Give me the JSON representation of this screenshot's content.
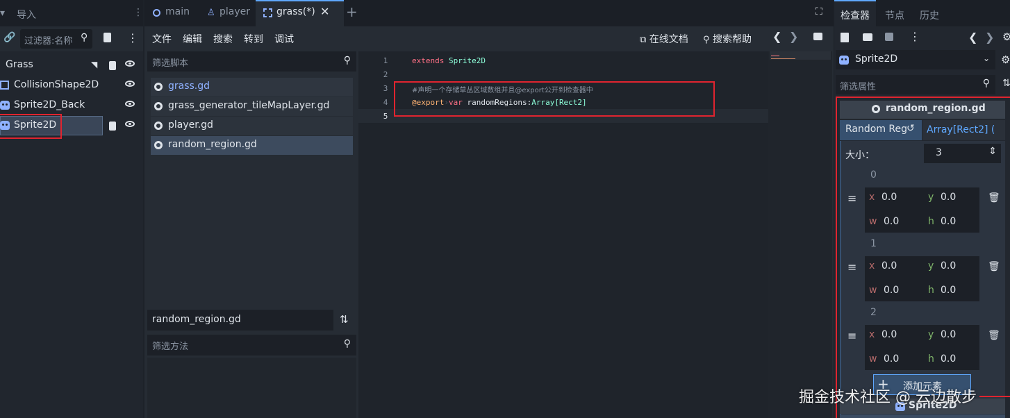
{
  "scene_panel": {
    "tabs": [
      "",
      "导入"
    ],
    "filter_placeholder": "过滤器:名称",
    "tree": [
      {
        "label": "Grass",
        "icon": "node2d-icon"
      },
      {
        "label": "CollisionShape2D",
        "icon": "collision-icon"
      },
      {
        "label": "Sprite2D_Back",
        "icon": "sprite-icon"
      },
      {
        "label": "Sprite2D",
        "icon": "sprite-icon"
      }
    ]
  },
  "doc_tabs": [
    {
      "label": "main",
      "icon": "circle-icon"
    },
    {
      "label": "player",
      "icon": "person-icon"
    },
    {
      "label": "grass(*)",
      "icon": "frame-icon"
    }
  ],
  "menubar": {
    "items": [
      "文件",
      "编辑",
      "搜索",
      "转到",
      "调试"
    ],
    "online_docs": "在线文档",
    "search_help": "搜索帮助"
  },
  "scripts": {
    "filter_placeholder": "筛选脚本",
    "items": [
      "grass.gd",
      "grass_generator_tileMapLayer.gd",
      "player.gd",
      "random_region.gd"
    ],
    "current_script": "random_region.gd",
    "method_filter_placeholder": "筛选方法"
  },
  "editor": {
    "line_numbers": [
      "1",
      "2",
      "3",
      "4",
      "5"
    ],
    "lines": {
      "l1_kw": "extends",
      "l1_cls": "Sprite2D",
      "l3_comment": "#声明一个存储草丛区域数组并且@export公开到检查器中",
      "l4_anno": "@export",
      "l4_kw": "var",
      "l4_name": "randomRegions",
      "l4_colon": ":",
      "l4_type": "Array[Rect2]"
    }
  },
  "inspector": {
    "tabs": [
      "检查器",
      "节点",
      "历史"
    ],
    "object": "Sprite2D",
    "filter_placeholder": "筛选属性",
    "script_header": "random_region.gd",
    "property_name": "Random Reg",
    "property_value": "Array[Rect2] (",
    "size_label": "大小：",
    "size_value": "3",
    "elements": [
      {
        "index": "0",
        "x": "0.0",
        "y": "0.0",
        "w": "0.0",
        "h": "0.0"
      },
      {
        "index": "1",
        "x": "0.0",
        "y": "0.0",
        "w": "0.0",
        "h": "0.0"
      },
      {
        "index": "2",
        "x": "0.0",
        "y": "0.0",
        "w": "0.0",
        "h": "0.0"
      }
    ],
    "add_element": "添加元素",
    "axis": {
      "x": "x",
      "y": "y",
      "w": "w",
      "h": "h"
    },
    "footer_object": "Sprite2D"
  },
  "watermark": "掘金技术社区 @ 云边散步",
  "colors": {
    "highlight_red": "#e0242f",
    "accent": "#5fa8ff"
  }
}
